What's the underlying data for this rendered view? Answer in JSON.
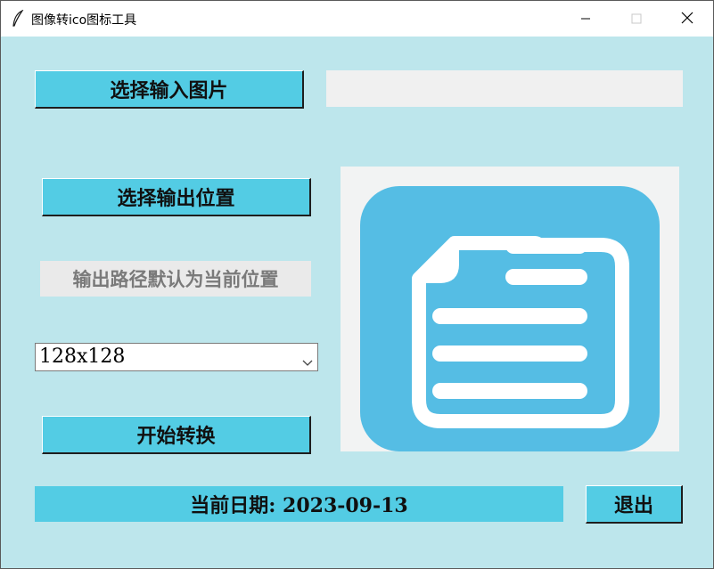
{
  "window": {
    "title": "图像转ico图标工具"
  },
  "titlebar": {
    "app_icon": "feather-icon",
    "minimize_icon": "minimize-icon",
    "maximize_icon": "maximize-icon",
    "close_icon": "close-icon"
  },
  "buttons": {
    "select_input": "选择输入图片",
    "select_output": "选择输出位置",
    "start_convert": "开始转换",
    "exit": "退出"
  },
  "input_path": {
    "value": ""
  },
  "output_hint": "输出路径默认为当前位置",
  "size_select": {
    "selected": "128x128",
    "arrow_icon": "chevron-down-icon"
  },
  "preview": {
    "icon": "document-icon"
  },
  "status": {
    "date_text": "当前日期: 2023-09-13"
  },
  "colors": {
    "background": "#bde6ec",
    "button": "#53cce4",
    "preview_tile": "#55bde4",
    "entry_bg": "#f0f0f0"
  }
}
